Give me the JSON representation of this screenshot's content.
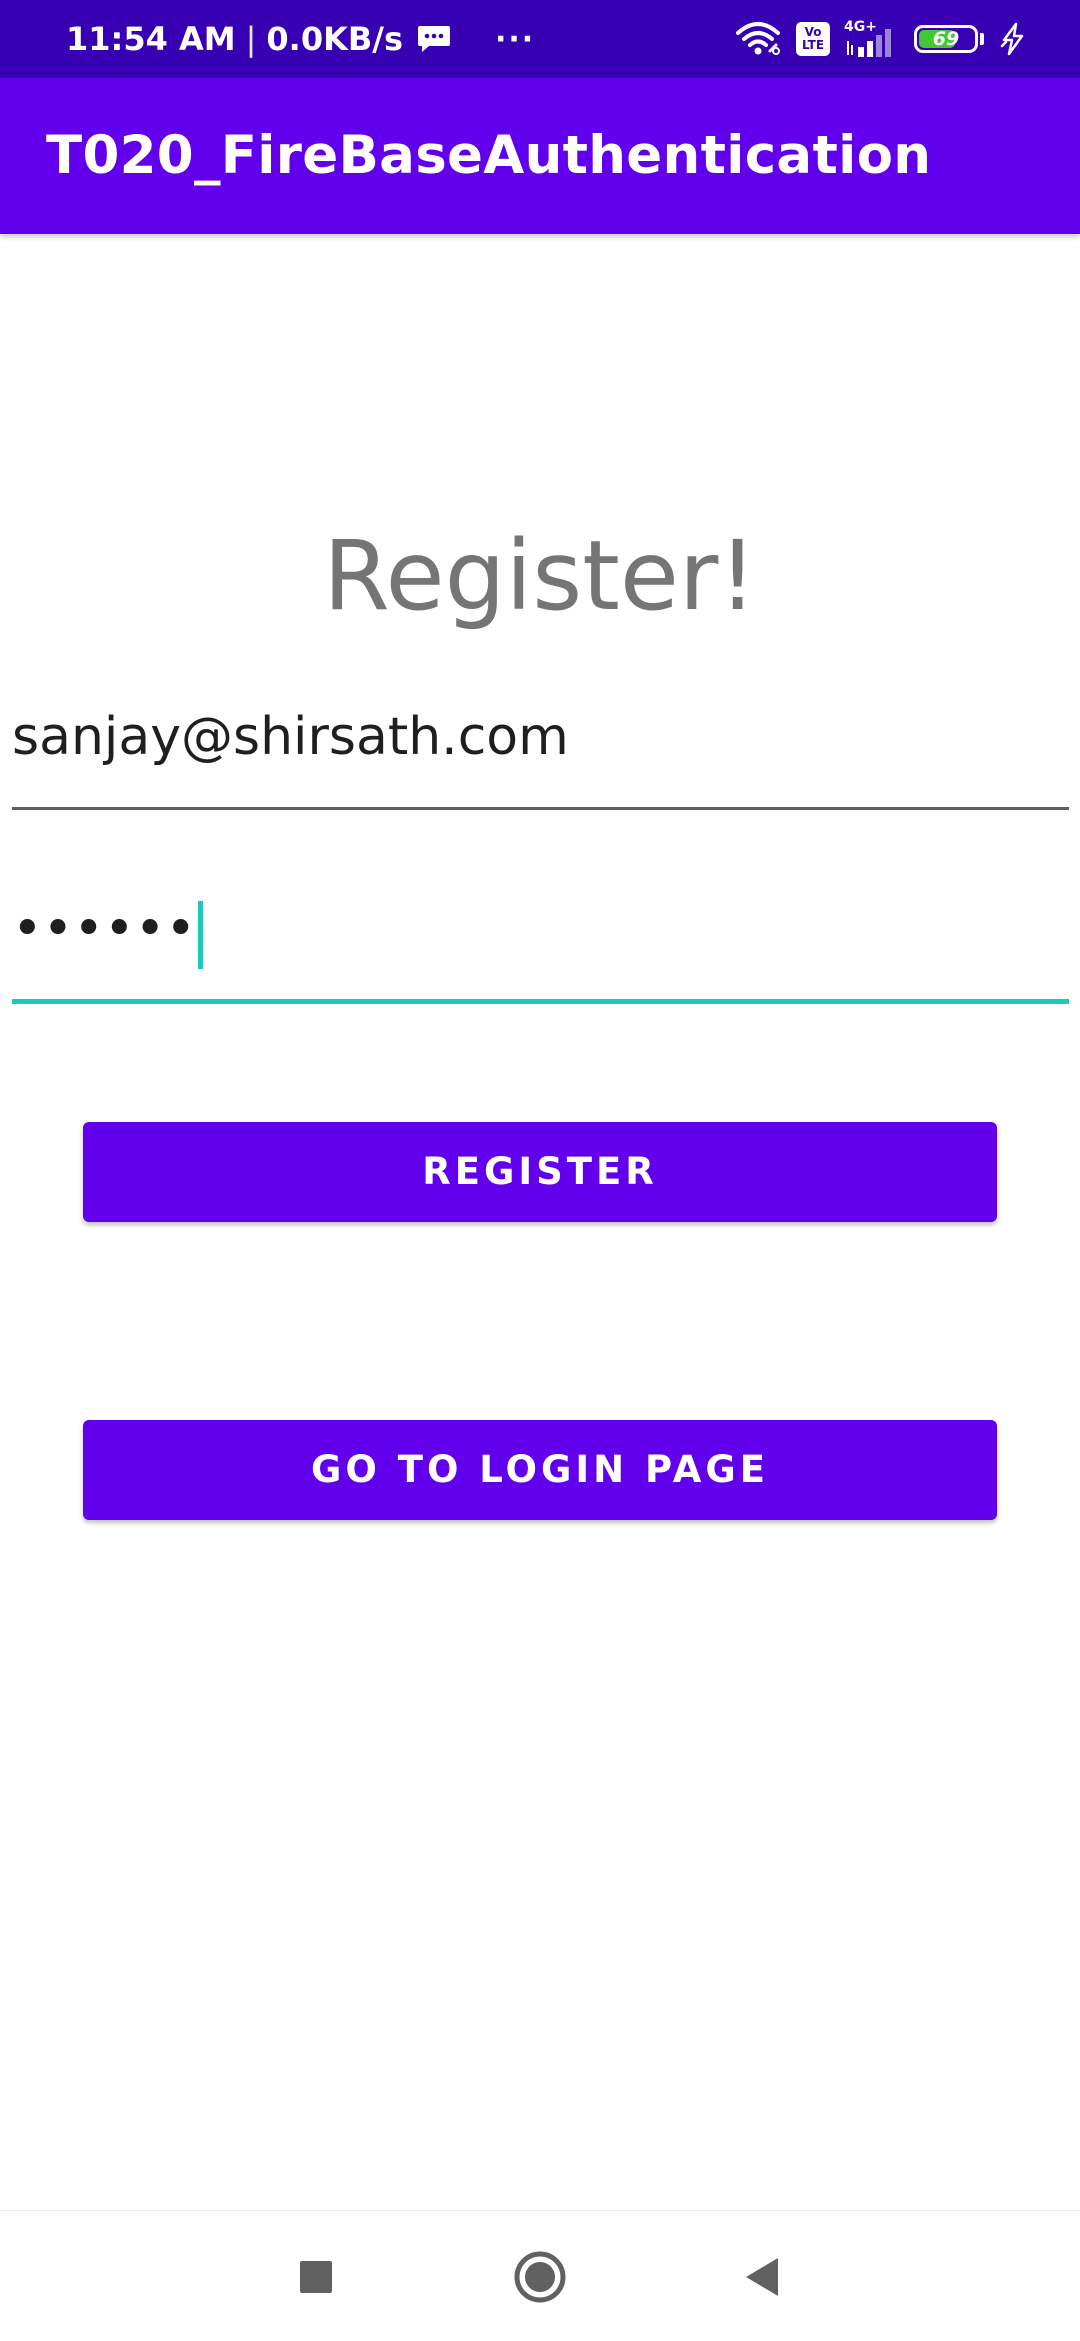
{
  "status_bar": {
    "time": "11:54 AM",
    "separator": "|",
    "net_speed": "0.0KB/s",
    "overflow": "···",
    "volte_label_1": "Vo",
    "volte_label_2": "LTE",
    "network_type": "4G+",
    "battery_level": "69",
    "battery_fraction": 0.69,
    "background_color": "#3700b3",
    "battery_color": "#41c832",
    "icons": [
      "message-icon",
      "wifi-icon",
      "volte-icon",
      "signal-icon",
      "battery-icon",
      "charging-icon"
    ]
  },
  "app_bar": {
    "title": "T020_FireBaseAuthentication",
    "background_color": "#6200ee"
  },
  "main": {
    "heading": "Register!",
    "email_field": {
      "value": "sanjay@shirsath.com"
    },
    "password_field": {
      "masked_value": "••••••",
      "focused": true,
      "accent_color": "#1ec8bd"
    },
    "register_button": {
      "label": "REGISTER"
    },
    "login_button": {
      "label": "GO TO LOGIN PAGE"
    },
    "button_color": "#6200ee"
  },
  "nav_bar": {
    "buttons": [
      "recents-icon",
      "home-icon",
      "back-icon"
    ]
  }
}
